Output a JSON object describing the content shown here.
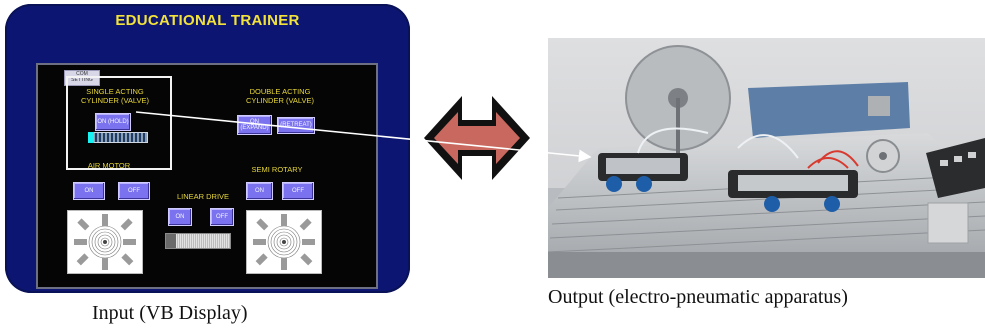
{
  "vb_display": {
    "title": "EDUCATIONAL TRAINER",
    "com_setting": "COM\nSETTING",
    "single_acting": {
      "label": "SINGLE ACTING\nCYLINDER (VALVE)",
      "on_button": "ON (HOLD)"
    },
    "double_acting": {
      "label": "DOUBLE ACTING\nCYLINDER (VALVE)",
      "expand_button": "ON\n(EXPAND)",
      "retreat_button": "(RETREAT)"
    },
    "air_motor": {
      "label": "AIR MOTOR",
      "on": "ON",
      "off": "OFF"
    },
    "semi_rotary": {
      "label": "SEMI ROTARY",
      "on": "ON",
      "off": "OFF"
    },
    "linear_drive": {
      "label": "LINEAR DRIVE",
      "on": "ON",
      "off": "OFF"
    },
    "colors": {
      "frame": "#0c1672",
      "label": "#e8d83a",
      "button": "#7a72ee",
      "screen": "#050505"
    }
  },
  "arrow": {
    "icon": "double-headed-arrow",
    "color": "#c8685e"
  },
  "captions": {
    "input": "Input (VB Display)",
    "output": "Output (electro-pneumatic apparatus)"
  }
}
